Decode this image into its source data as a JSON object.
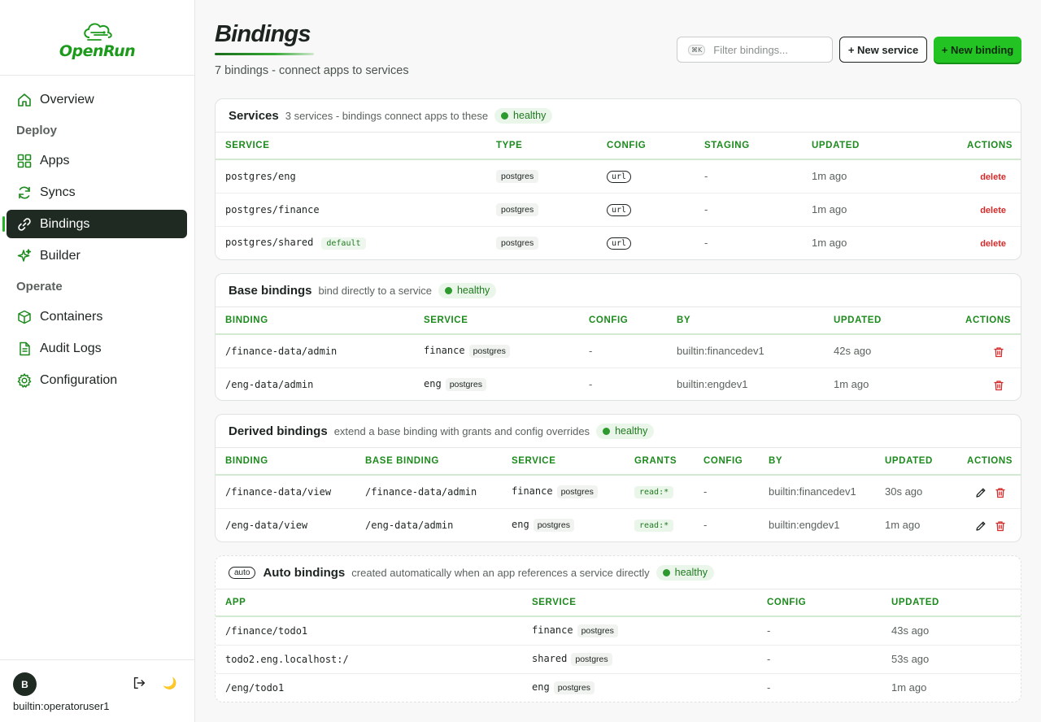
{
  "brand": {
    "name": "OpenRun"
  },
  "nav": {
    "overview": "Overview",
    "deploy_section": "Deploy",
    "apps": "Apps",
    "syncs": "Syncs",
    "bindings": "Bindings",
    "builder": "Builder",
    "operate_section": "Operate",
    "containers": "Containers",
    "audit_logs": "Audit Logs",
    "configuration": "Configuration"
  },
  "user": {
    "initial": "B",
    "name": "builtin:operatoruser1"
  },
  "header": {
    "title": "Bindings",
    "subtitle": "7 bindings - connect apps to services",
    "filter_shortcut": "⌘K",
    "filter_placeholder": "Filter bindings...",
    "new_service": "+ New service",
    "new_binding": "+ New binding"
  },
  "services": {
    "title": "Services",
    "desc": "3 services - bindings connect apps to these",
    "status": "healthy",
    "columns": [
      "SERVICE",
      "TYPE",
      "CONFIG",
      "STAGING",
      "UPDATED",
      "ACTIONS"
    ],
    "rows": [
      {
        "name": "postgres/eng",
        "tag": "",
        "type": "postgres",
        "config": "url",
        "staging": "-",
        "updated": "1m ago",
        "action": "delete"
      },
      {
        "name": "postgres/finance",
        "tag": "",
        "type": "postgres",
        "config": "url",
        "staging": "-",
        "updated": "1m ago",
        "action": "delete"
      },
      {
        "name": "postgres/shared",
        "tag": "default",
        "type": "postgres",
        "config": "url",
        "staging": "-",
        "updated": "1m ago",
        "action": "delete"
      }
    ]
  },
  "base": {
    "title": "Base bindings",
    "desc": "bind directly to a service",
    "status": "healthy",
    "columns": [
      "BINDING",
      "SERVICE",
      "CONFIG",
      "BY",
      "UPDATED",
      "ACTIONS"
    ],
    "rows": [
      {
        "binding": "/finance-data/admin",
        "service": "finance",
        "type": "postgres",
        "config": "-",
        "by": "builtin:financedev1",
        "updated": "42s ago"
      },
      {
        "binding": "/eng-data/admin",
        "service": "eng",
        "type": "postgres",
        "config": "-",
        "by": "builtin:engdev1",
        "updated": "1m ago"
      }
    ]
  },
  "derived": {
    "title": "Derived bindings",
    "desc": "extend a base binding with grants and config overrides",
    "status": "healthy",
    "columns": [
      "BINDING",
      "BASE BINDING",
      "SERVICE",
      "GRANTS",
      "CONFIG",
      "BY",
      "UPDATED",
      "ACTIONS"
    ],
    "rows": [
      {
        "binding": "/finance-data/view",
        "base": "/finance-data/admin",
        "service": "finance",
        "type": "postgres",
        "grants": "read:*",
        "config": "-",
        "by": "builtin:financedev1",
        "updated": "30s ago"
      },
      {
        "binding": "/eng-data/view",
        "base": "/eng-data/admin",
        "service": "eng",
        "type": "postgres",
        "grants": "read:*",
        "config": "-",
        "by": "builtin:engdev1",
        "updated": "1m ago"
      }
    ]
  },
  "auto": {
    "tag": "auto",
    "title": "Auto bindings",
    "desc": "created automatically when an app references a service directly",
    "status": "healthy",
    "columns": [
      "APP",
      "SERVICE",
      "CONFIG",
      "UPDATED"
    ],
    "rows": [
      {
        "app": "/finance/todo1",
        "service": "finance",
        "type": "postgres",
        "config": "-",
        "updated": "43s ago"
      },
      {
        "app": "todo2.eng.localhost:/",
        "service": "shared",
        "type": "postgres",
        "config": "-",
        "updated": "53s ago"
      },
      {
        "app": "/eng/todo1",
        "service": "eng",
        "type": "postgres",
        "config": "-",
        "updated": "1m ago"
      }
    ]
  },
  "colors": {
    "accent": "#22c322",
    "active_nav": "#1e2a22",
    "danger": "#d42a2a",
    "header_green": "#1c8a1c"
  }
}
